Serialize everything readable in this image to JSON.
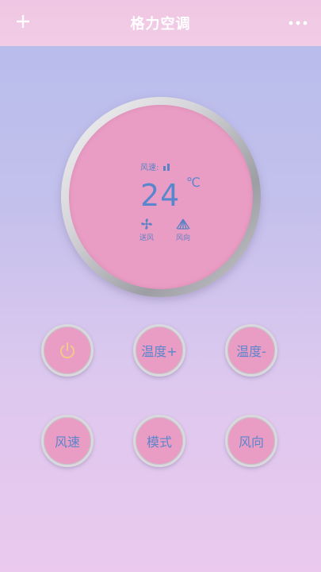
{
  "header": {
    "title": "格力空调"
  },
  "display": {
    "wind_label": "风速:",
    "temperature": "24",
    "unit": "℃",
    "mode_label": "送风",
    "direction_label": "风向"
  },
  "buttons": {
    "temp_up": "温度+",
    "temp_down": "温度-",
    "fan_speed": "风速",
    "mode": "模式",
    "direction": "风向"
  },
  "colors": {
    "accent_text": "#5a86cd",
    "dial_fill": "#ea9dc4",
    "power_icon": "#f0c88a"
  }
}
